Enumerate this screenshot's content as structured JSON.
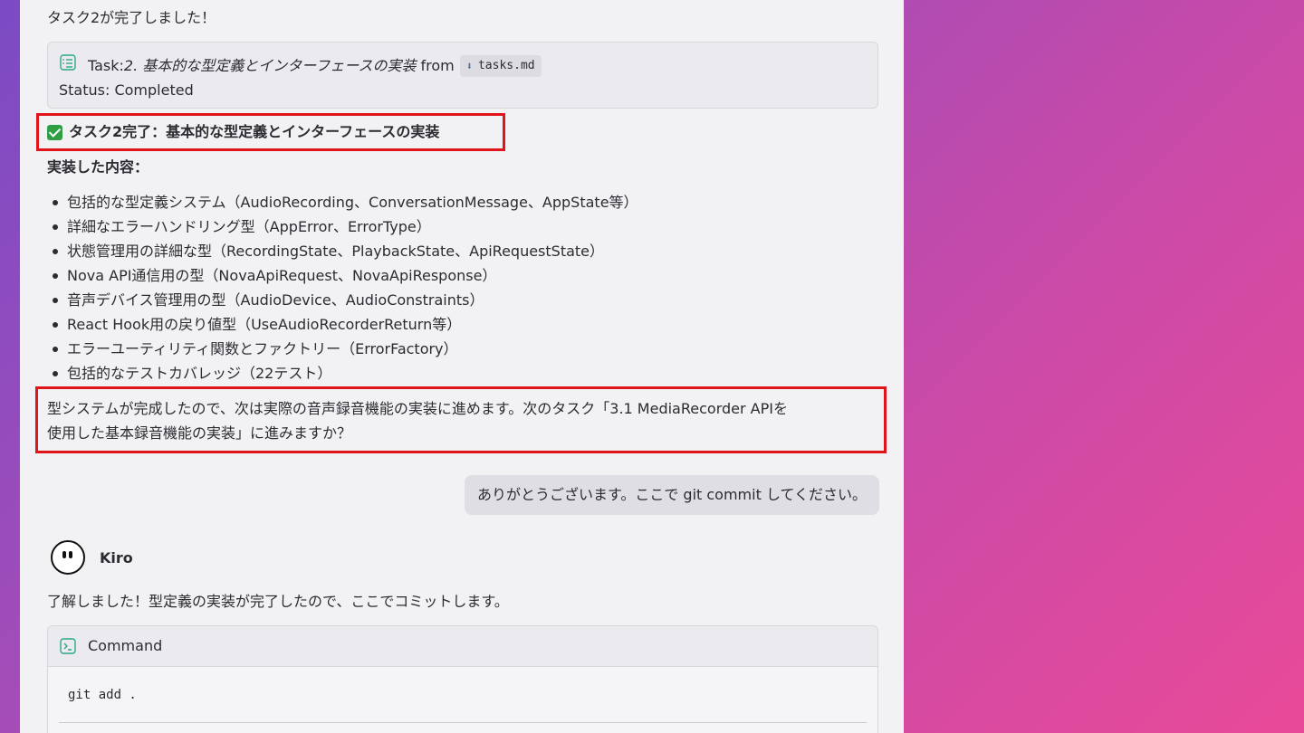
{
  "previous_message": "タスク2が完了しました！",
  "task_card": {
    "prefix": "Task: ",
    "task_name": "2. 基本的な型定義とインターフェースの実装",
    "from_label": "from",
    "file_icon": "download-arrow-icon",
    "file_name": "tasks.md",
    "status": "Status: Completed"
  },
  "completion": {
    "heading": "タスク2完了：基本的な型定義とインターフェースの実装",
    "subheading": "実装した内容：",
    "items": [
      "包括的な型定義システム（AudioRecording、ConversationMessage、AppState等）",
      "詳細なエラーハンドリング型（AppError、ErrorType）",
      "状態管理用の詳細な型（RecordingState、PlaybackState、ApiRequestState）",
      "Nova API通信用の型（NovaApiRequest、NovaApiResponse）",
      "音声デバイス管理用の型（AudioDevice、AudioConstraints）",
      "React Hook用の戻り値型（UseAudioRecorderReturn等）",
      "エラーユーティリティ関数とファクトリー（ErrorFactory）",
      "包括的なテストカバレッジ（22テスト）"
    ],
    "next_step_line1": "型システムが完成したので、次は実際の音声録音機能の実装に進めます。次のタスク「3.1 MediaRecorder APIを",
    "next_step_line2": "使用した基本録音機能の実装」に進みますか？"
  },
  "user_message": "ありがとうございます。ここで git commit してください。",
  "agent": {
    "name": "Kiro",
    "reply": "了解しました！型定義の実装が完了したので、ここでコミットします。"
  },
  "command_card": {
    "title": "Command",
    "code": "git add ."
  },
  "colors": {
    "highlight_border": "#e0141b",
    "check_green": "#2f9e44",
    "icon_teal": "#2aa88a"
  }
}
